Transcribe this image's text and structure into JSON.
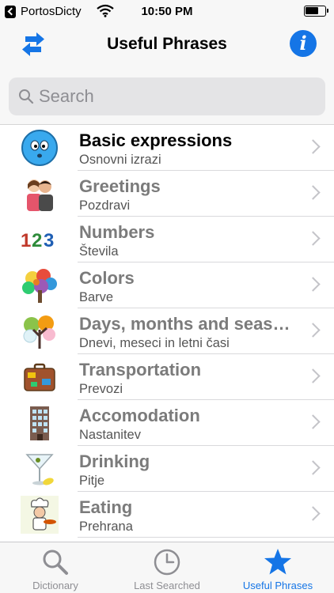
{
  "status_bar": {
    "carrier": "PortosDicty",
    "time": "10:50 PM"
  },
  "nav": {
    "title": "Useful Phrases",
    "swap_icon": "swap-arrows-icon",
    "info_icon": "info-icon",
    "info_glyph": "i",
    "accent_color": "#1575e6"
  },
  "search": {
    "placeholder": "Search",
    "value": ""
  },
  "categories": [
    {
      "title": "Basic expressions",
      "subtitle": "Osnovni izrazi",
      "icon": "smiley-face-icon"
    },
    {
      "title": "Greetings",
      "subtitle": "Pozdravi",
      "icon": "greeting-couple-icon"
    },
    {
      "title": "Numbers",
      "subtitle": "Števila",
      "icon": "numbers-123-icon",
      "icon_text": "123"
    },
    {
      "title": "Colors",
      "subtitle": "Barve",
      "icon": "colorful-tree-icon"
    },
    {
      "title": "Days, months and seasons",
      "subtitle": "Dnevi, meseci in letni časi",
      "icon": "seasons-tree-icon"
    },
    {
      "title": "Transportation",
      "subtitle": "Prevozi",
      "icon": "suitcase-icon"
    },
    {
      "title": "Accomodation",
      "subtitle": "Nastanitev",
      "icon": "building-icon"
    },
    {
      "title": "Drinking",
      "subtitle": "Pitje",
      "icon": "martini-glass-icon"
    },
    {
      "title": "Eating",
      "subtitle": "Prehrana",
      "icon": "chef-icon"
    }
  ],
  "tab_bar": {
    "tabs": [
      {
        "label": "Dictionary",
        "icon": "magnifier-icon",
        "active": false
      },
      {
        "label": "Last Searched",
        "icon": "clock-icon",
        "active": false
      },
      {
        "label": "Useful Phrases",
        "icon": "star-icon",
        "active": true
      }
    ]
  }
}
